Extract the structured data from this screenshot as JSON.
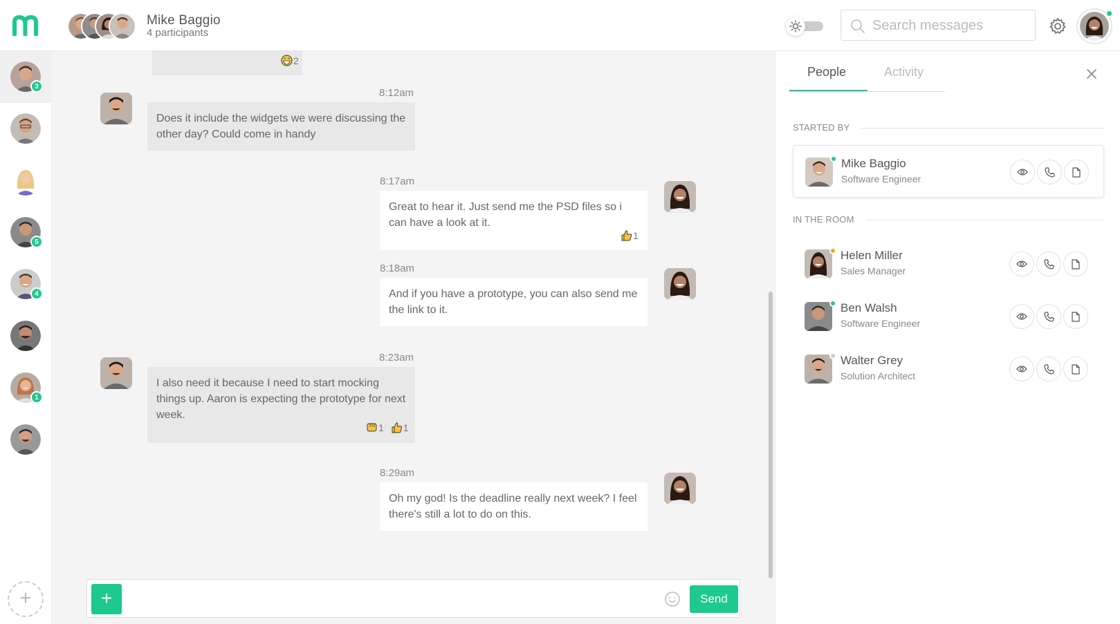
{
  "header": {
    "chat_title": "Mike Baggio",
    "participants_label": "4 participants"
  },
  "search": {
    "placeholder": "Search messages"
  },
  "rail": {
    "badges": [
      "3",
      "5",
      "4",
      "1"
    ],
    "add_label": "+"
  },
  "messages": [
    {
      "dir": "in",
      "time": "",
      "reactions": [
        {
          "icon": "grin-emoji",
          "count": "2"
        }
      ]
    },
    {
      "dir": "in",
      "time": "8:12am",
      "text": "Does it include the widgets we were discussing the other day? Could come in handy"
    },
    {
      "dir": "out",
      "time": "8:17am",
      "text": "Great to hear it. Just send me the PSD files so i can have a look at it.",
      "reactions": [
        {
          "icon": "thumbs-up-emoji",
          "count": "1"
        }
      ]
    },
    {
      "dir": "out",
      "time": "8:18am",
      "text": "And if you have a prototype, you can also send me the link to it."
    },
    {
      "dir": "in",
      "time": "8:23am",
      "text": "I also need it because I need to start mocking things up. Aaron is expecting the prototype for next week.",
      "reactions": [
        {
          "icon": "fist-bump-emoji",
          "count": "1"
        },
        {
          "icon": "thumbs-up-emoji",
          "count": "1"
        }
      ]
    },
    {
      "dir": "out",
      "time": "8:29am",
      "text": "Oh my god! Is the deadline really next week? I feel there's still a lot to do on this."
    }
  ],
  "composer": {
    "plus_label": "+",
    "send_label": "Send",
    "placeholder": ""
  },
  "panel": {
    "tabs": [
      "People",
      "Activity"
    ],
    "started_by_title": "STARTED BY",
    "in_room_title": "IN THE ROOM",
    "starter": {
      "name": "Mike Baggio",
      "role": "Software Engineer",
      "status_color": "#1dc98e"
    },
    "people": [
      {
        "name": "Helen Miller",
        "role": "Sales Manager",
        "status_color": "#f5a623"
      },
      {
        "name": "Ben Walsh",
        "role": "Software Engineer",
        "status_color": "#1dc98e"
      },
      {
        "name": "Walter Grey",
        "role": "Solution Architect",
        "status_color": "#cccccc"
      }
    ]
  },
  "colors": {
    "accent": "#1dc98e",
    "chat_bg": "#f4f4f4",
    "bubble_in": "#e8e8e8"
  }
}
